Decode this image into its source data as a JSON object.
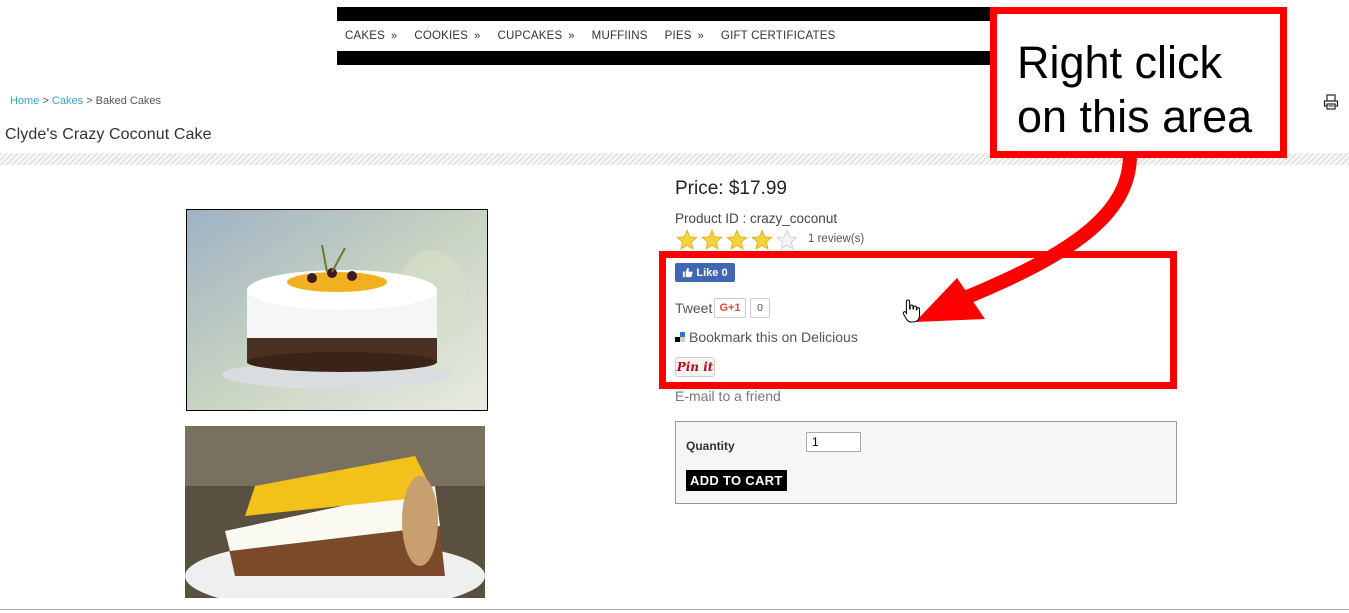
{
  "nav": {
    "items": [
      {
        "label": "CAKES",
        "chev": "»"
      },
      {
        "label": "COOKIES",
        "chev": "»"
      },
      {
        "label": "CUPCAKES",
        "chev": "»"
      },
      {
        "label": "MUFFIINS",
        "chev": ""
      },
      {
        "label": "PIES",
        "chev": "»"
      },
      {
        "label": "GIFT CERTIFICATES",
        "chev": ""
      }
    ]
  },
  "breadcrumb": {
    "home": "Home",
    "sep1": " > ",
    "cakes": "Cakes",
    "sep2": " > ",
    "current": "Baked Cakes"
  },
  "product": {
    "title": "Clyde's Crazy Coconut Cake",
    "price": "Price: $17.99",
    "product_id": "Product ID : crazy_coconut",
    "rating": 4,
    "rating_max": 5,
    "reviews": "1 review(s)"
  },
  "social": {
    "fb_like": "Like 0",
    "tweet": "Tweet",
    "gplus": "G+1",
    "gplus_count": "0",
    "delicious": "Bookmark this on Delicious",
    "pinit": "Pin it",
    "email_friend": "E-mail to a friend"
  },
  "cart": {
    "qty_label": "Quantity",
    "qty_value": "1",
    "add_label": "ADD TO CART"
  },
  "annotation": {
    "line1": "Right click",
    "line2": "on this area"
  },
  "colors": {
    "annotation_red": "#ff0000",
    "link_blue": "#3aa3c7",
    "fb_blue": "#4267b2",
    "pin_red": "#bd081c"
  },
  "icons": {
    "print": "print-icon",
    "cursor": "hand-cursor-icon",
    "arrow": "annotation-arrow"
  }
}
